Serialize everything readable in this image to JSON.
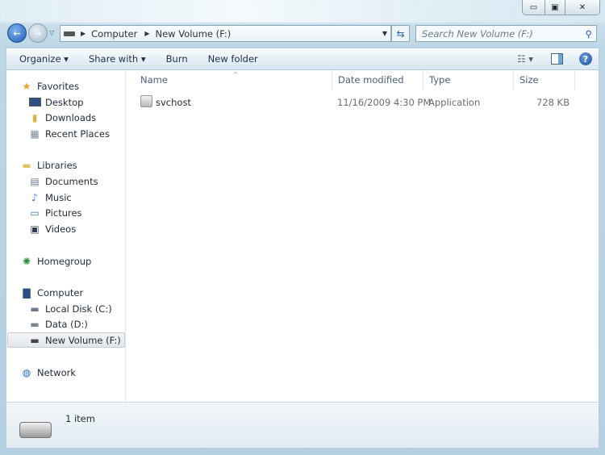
{
  "window": {
    "minimize_icon": "minimize-icon",
    "maximize_icon": "maximize-icon",
    "close_icon": "close-icon"
  },
  "address": {
    "segments": [
      "Computer",
      "New Volume (F:)"
    ]
  },
  "search": {
    "placeholder": "Search New Volume (F:)"
  },
  "toolbar": {
    "organize": "Organize",
    "share_with": "Share with",
    "burn": "Burn",
    "new_folder": "New folder"
  },
  "nav": {
    "favorites": {
      "label": "Favorites",
      "items": [
        "Desktop",
        "Downloads",
        "Recent Places"
      ]
    },
    "libraries": {
      "label": "Libraries",
      "items": [
        "Documents",
        "Music",
        "Pictures",
        "Videos"
      ]
    },
    "homegroup": "Homegroup",
    "computer": {
      "label": "Computer",
      "items": [
        "Local Disk (C:)",
        "Data (D:)",
        "New Volume (F:)"
      ]
    },
    "network": "Network"
  },
  "columns": {
    "name": "Name",
    "date": "Date modified",
    "type": "Type",
    "size": "Size"
  },
  "files": [
    {
      "name": "svchost",
      "date": "11/16/2009 4:30 PM",
      "type": "Application",
      "size": "728 KB"
    }
  ],
  "status": {
    "count": "1 item"
  }
}
